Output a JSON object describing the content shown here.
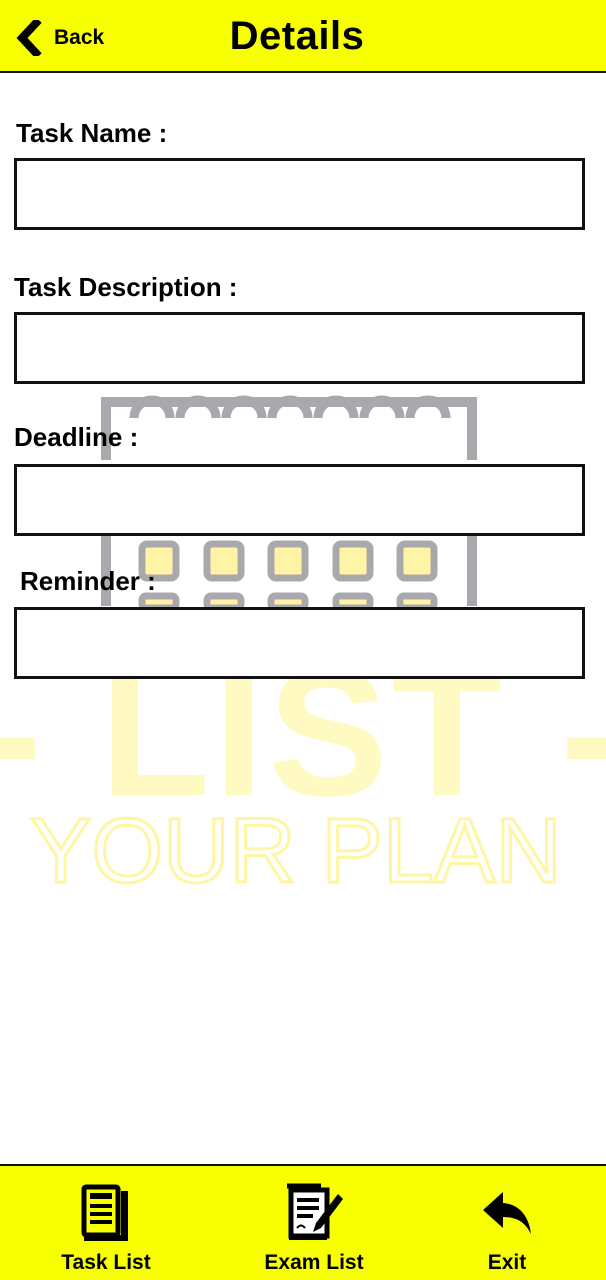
{
  "header": {
    "back_label": "Back",
    "title": "Details",
    "background": "#f7ff00"
  },
  "form": {
    "task_name_label": "Task Name :",
    "task_name_value": "",
    "task_description_label": "Task Description :",
    "task_description_value": "",
    "deadline_label": "Deadline :",
    "deadline_value": "",
    "reminder_label": "Reminder :",
    "reminder_value": ""
  },
  "watermark": {
    "line1": "- LIST -",
    "line2": "YOUR PLAN",
    "icon": "calendar-icon",
    "color": "#fff9b8"
  },
  "nav": {
    "task_list_label": "Task List",
    "task_list_icon": "notebook-icon",
    "exam_list_label": "Exam List",
    "exam_list_icon": "document-pen-icon",
    "exit_label": "Exit",
    "exit_icon": "reply-arrow-icon"
  }
}
